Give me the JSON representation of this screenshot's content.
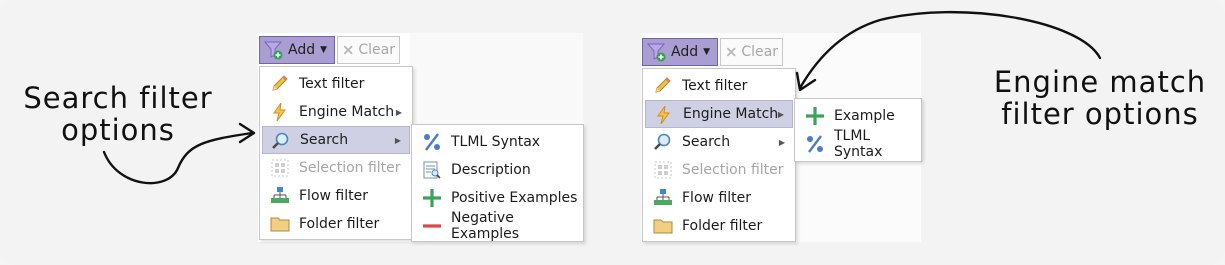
{
  "left_screen": {
    "toolbar": {
      "add_label": "Add",
      "clear_label": "Clear"
    },
    "main_menu": [
      {
        "label": "Text filter",
        "icon": "pencil-icon",
        "state": "normal",
        "submenu": false
      },
      {
        "label": "Engine Match",
        "icon": "lightning-icon",
        "state": "normal",
        "submenu": true
      },
      {
        "label": "Search",
        "icon": "magnifier-icon",
        "state": "active",
        "submenu": true
      },
      {
        "label": "Selection filter",
        "icon": "selection-icon",
        "state": "disabled",
        "submenu": false
      },
      {
        "label": "Flow filter",
        "icon": "flow-icon",
        "state": "normal",
        "submenu": false
      },
      {
        "label": "Folder filter",
        "icon": "folder-icon",
        "state": "normal",
        "submenu": false
      }
    ],
    "submenu": [
      {
        "label": "TLML Syntax",
        "icon": "percent-icon"
      },
      {
        "label": "Description",
        "icon": "description-icon"
      },
      {
        "label": "Positive Examples",
        "icon": "plus-icon"
      },
      {
        "label": "Negative Examples",
        "icon": "minus-icon"
      }
    ],
    "annotation": "Search filter options"
  },
  "right_screen": {
    "toolbar": {
      "add_label": "Add",
      "clear_label": "Clear"
    },
    "main_menu": [
      {
        "label": "Text filter",
        "icon": "pencil-icon",
        "state": "normal",
        "submenu": false
      },
      {
        "label": "Engine Match",
        "icon": "lightning-icon",
        "state": "active",
        "submenu": true
      },
      {
        "label": "Search",
        "icon": "magnifier-icon",
        "state": "normal",
        "submenu": true
      },
      {
        "label": "Selection filter",
        "icon": "selection-icon",
        "state": "disabled",
        "submenu": false
      },
      {
        "label": "Flow filter",
        "icon": "flow-icon",
        "state": "normal",
        "submenu": false
      },
      {
        "label": "Folder filter",
        "icon": "folder-icon",
        "state": "normal",
        "submenu": false
      }
    ],
    "submenu": [
      {
        "label": "Example",
        "icon": "plus-icon"
      },
      {
        "label": "TLML Syntax",
        "icon": "percent-icon"
      }
    ],
    "annotation": "Engine match filter options"
  },
  "colors": {
    "add_button": "#a99dd2",
    "active_item": "#cfd0e3",
    "disabled_text": "#a5a5a5",
    "plus_green": "#3aa35a",
    "minus_red": "#d9474f",
    "percent_blue": "#4a7bc8"
  }
}
